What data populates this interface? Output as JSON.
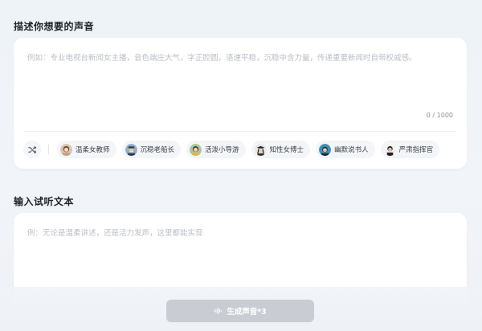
{
  "section1": {
    "title": "描述你想要的声音",
    "placeholder": "例如：专业电视台新闻女主播，音色端庄大气，字正腔圆，语速平稳，沉稳中含力量，传递重要新闻时自带权威感。",
    "counter": "0 / 1000"
  },
  "presets": [
    {
      "label": "温柔女教师",
      "icon": "avatar-female-teacher"
    },
    {
      "label": "沉稳老船长",
      "icon": "avatar-old-captain"
    },
    {
      "label": "活泼小导游",
      "icon": "avatar-tour-guide"
    },
    {
      "label": "知性女博士",
      "icon": "avatar-female-doctor"
    },
    {
      "label": "幽默说书人",
      "icon": "avatar-storyteller"
    },
    {
      "label": "严肃指挥官",
      "icon": "avatar-commander"
    }
  ],
  "section2": {
    "title": "输入试听文本",
    "placeholder": "例：无论是温柔讲述，还是活力发声，这里都能实现"
  },
  "generate": {
    "label": "生成声音*3",
    "icon": "waveform-icon"
  }
}
